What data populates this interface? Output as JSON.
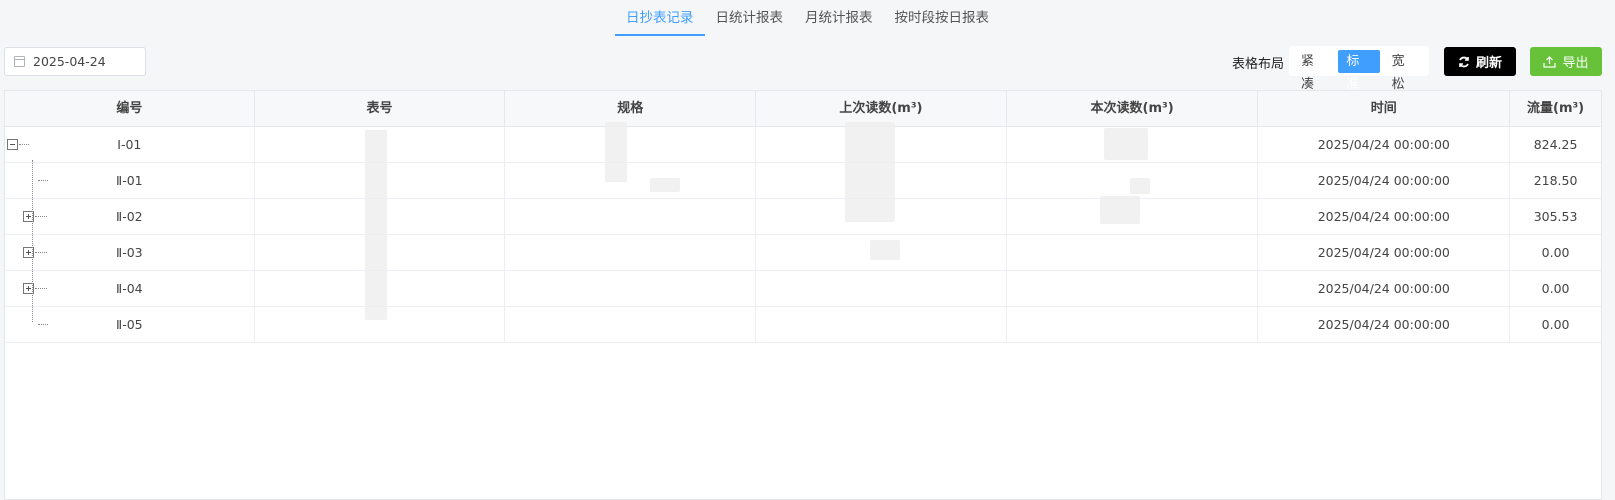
{
  "tabs": [
    "日抄表记录",
    "日统计报表",
    "月统计报表",
    "按时段按日报表"
  ],
  "toolbar": {
    "date_value": "2025-04-24",
    "layout_label": "表格布局",
    "layout_options": [
      "紧凑",
      "标准",
      "宽松"
    ],
    "layout_selected": "标准",
    "refresh_label": "刷新",
    "export_label": "导出"
  },
  "table": {
    "headers": [
      "编号",
      "表号",
      "规格",
      "上次读数(m³)",
      "本次读数(m³)",
      "时间",
      "流量(m³)"
    ],
    "rows": [
      {
        "code": "Ⅰ-01",
        "time": "2025/04/24 00:00:00",
        "flow": "824.25"
      },
      {
        "code": "Ⅱ-01",
        "time": "2025/04/24 00:00:00",
        "flow": "218.50"
      },
      {
        "code": "Ⅱ-02",
        "time": "2025/04/24 00:00:00",
        "flow": "305.53"
      },
      {
        "code": "Ⅱ-03",
        "time": "2025/04/24 00:00:00",
        "flow": "0.00"
      },
      {
        "code": "Ⅱ-04",
        "time": "2025/04/24 00:00:00",
        "flow": "0.00"
      },
      {
        "code": "Ⅱ-05",
        "time": "2025/04/24 00:00:00",
        "flow": "0.00"
      }
    ]
  },
  "colors": {
    "accent": "#409eff",
    "export": "#67c23a",
    "refresh": "#000000"
  }
}
